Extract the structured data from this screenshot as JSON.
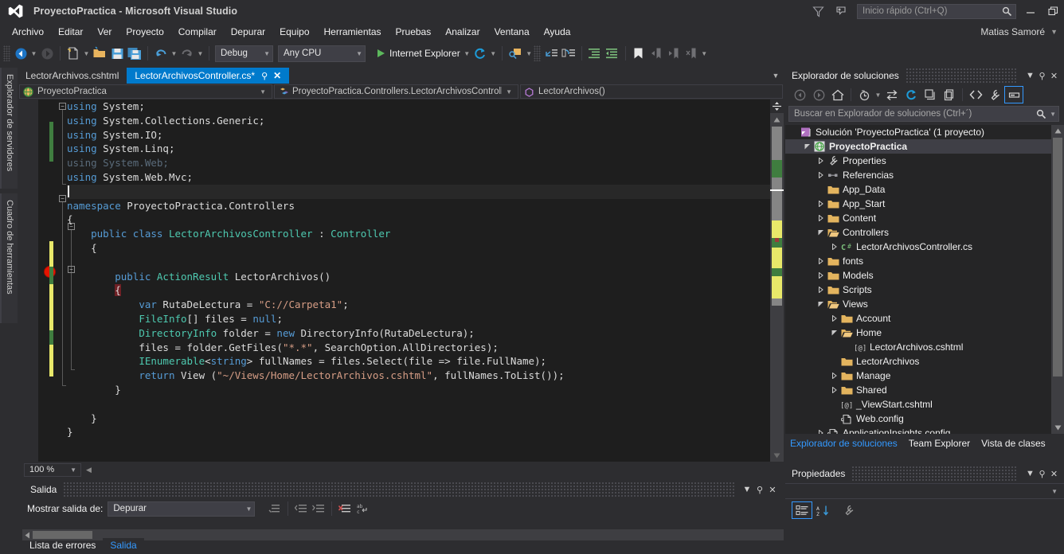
{
  "titlebar": {
    "title": "ProyectoPractica - Microsoft Visual Studio",
    "logo_icon": "visual-studio-logo-icon",
    "feedback_icon": "feedback-icon",
    "notify_icon": "notification-icon",
    "quick_launch_placeholder": "Inicio rápido (Ctrl+Q)",
    "quick_launch_value": "",
    "search_icon": "search-icon",
    "minimize_icon": "minimize-icon",
    "restore_icon": "restore-icon",
    "user": "Matias Samoré",
    "user_caret_icon": "chevron-down-icon"
  },
  "menubar": {
    "items": [
      "Archivo",
      "Editar",
      "Ver",
      "Proyecto",
      "Compilar",
      "Depurar",
      "Equipo",
      "Herramientas",
      "Pruebas",
      "Analizar",
      "Ventana",
      "Ayuda"
    ]
  },
  "toolbar": {
    "nav_back_icon": "navigate-back-icon",
    "nav_forward_icon": "navigate-forward-icon",
    "new_item_icon": "new-item-icon",
    "open_file_icon": "open-file-icon",
    "save_icon": "save-icon",
    "save_all_icon": "save-all-icon",
    "undo_icon": "undo-icon",
    "redo_icon": "redo-icon",
    "config_value": "Debug",
    "platform_value": "Any CPU",
    "run_label": "Internet Explorer",
    "run_icon": "play-icon",
    "refresh_icon": "refresh-icon",
    "find_icon": "find-in-files-icon",
    "step_into_icon": "step-into-icon",
    "step_over_icon": "step-over-icon",
    "indent_icon": "increase-indent-icon",
    "outdent_icon": "decrease-indent-icon",
    "bookmark_icon": "bookmark-icon",
    "prev_bookmark_icon": "previous-bookmark-icon",
    "next_bookmark_icon": "next-bookmark-icon",
    "clear_bookmark_icon": "clear-bookmark-icon",
    "overflow_icon": "toolbar-overflow-icon"
  },
  "left_vertical_tabs": [
    {
      "label": "Explorador de servidores",
      "icon": "server-explorer-icon"
    },
    {
      "label": "Cuadro de herramientas",
      "icon": "toolbox-icon"
    }
  ],
  "editor": {
    "tabs": [
      {
        "label": "LectorArchivos.cshtml",
        "active": false
      },
      {
        "label": "LectorArchivosController.cs*",
        "active": true
      }
    ],
    "tab_pin_icon": "pin-icon",
    "tab_close_icon": "close-icon",
    "tabstrip_overflow_icon": "chevron-down-icon",
    "navbar": {
      "project": "ProyectoPractica",
      "project_icon": "web-project-icon",
      "type": "ProyectoPractica.Controllers.LectorArchivosController",
      "type_icon": "class-icon",
      "member": "LectorArchivos()",
      "member_icon": "method-icon",
      "caret_icon": "chevron-down-icon"
    },
    "zoom_level": "100 %",
    "zoom_caret_icon": "chevron-down-icon",
    "scroll_up_icon": "scroll-up-arrow-icon",
    "scroll_down_icon": "scroll-down-arrow-icon",
    "split_icon": "split-view-icon",
    "breakpoint_icon": "breakpoint-icon",
    "code_lines": [
      {
        "indent": 0,
        "fold": "minus",
        "tokens": [
          [
            "kw",
            "using"
          ],
          [
            "pln",
            " "
          ],
          [
            "pln",
            "System;"
          ]
        ]
      },
      {
        "indent": 0,
        "tokens": [
          [
            "kw",
            "using"
          ],
          [
            "pln",
            " "
          ],
          [
            "pln",
            "System.Collections.Generic;"
          ]
        ]
      },
      {
        "indent": 0,
        "tokens": [
          [
            "kw",
            "using"
          ],
          [
            "pln",
            " "
          ],
          [
            "pln",
            "System.IO;"
          ]
        ]
      },
      {
        "indent": 0,
        "tokens": [
          [
            "kw",
            "using"
          ],
          [
            "pln",
            " "
          ],
          [
            "pln",
            "System.Linq;"
          ]
        ]
      },
      {
        "indent": 0,
        "dimmed": true,
        "tokens": [
          [
            "dim",
            "using System.Web;"
          ]
        ]
      },
      {
        "indent": 0,
        "tokens": [
          [
            "kw",
            "using"
          ],
          [
            "pln",
            " "
          ],
          [
            "pln",
            "System.Web.Mvc;"
          ]
        ]
      },
      {
        "indent": 0,
        "caret": true,
        "tokens": []
      },
      {
        "indent": 0,
        "fold": "minus",
        "tokens": [
          [
            "kw",
            "namespace"
          ],
          [
            "pln",
            " ProyectoPractica.Controllers"
          ]
        ]
      },
      {
        "indent": 0,
        "tokens": [
          [
            "pln",
            "{"
          ]
        ]
      },
      {
        "indent": 1,
        "fold": "minus",
        "tokens": [
          [
            "kw",
            "public"
          ],
          [
            "pln",
            " "
          ],
          [
            "kw",
            "class"
          ],
          [
            "pln",
            " "
          ],
          [
            "typ",
            "LectorArchivosController"
          ],
          [
            "pln",
            " : "
          ],
          [
            "typ",
            "Controller"
          ]
        ]
      },
      {
        "indent": 1,
        "tokens": [
          [
            "pln",
            "{"
          ]
        ]
      },
      {
        "indent": 1,
        "tokens": []
      },
      {
        "indent": 2,
        "fold": "minus",
        "tokens": [
          [
            "kw",
            "public"
          ],
          [
            "pln",
            " "
          ],
          [
            "typ",
            "ActionResult"
          ],
          [
            "pln",
            " LectorArchivos()"
          ]
        ]
      },
      {
        "indent": 2,
        "breakpoint_line": true,
        "tokens": [
          [
            "bp",
            "{"
          ]
        ]
      },
      {
        "indent": 3,
        "tokens": [
          [
            "kw",
            "var"
          ],
          [
            "pln",
            " RutaDeLectura = "
          ],
          [
            "str",
            "\"C://Carpeta1\""
          ],
          [
            "pln",
            ";"
          ]
        ]
      },
      {
        "indent": 3,
        "tokens": [
          [
            "typ",
            "FileInfo"
          ],
          [
            "pln",
            "[] files = "
          ],
          [
            "kw",
            "null"
          ],
          [
            "pln",
            ";"
          ]
        ]
      },
      {
        "indent": 3,
        "tokens": [
          [
            "typ",
            "DirectoryInfo"
          ],
          [
            "pln",
            " folder = "
          ],
          [
            "kw",
            "new"
          ],
          [
            "pln",
            " DirectoryInfo(RutaDeLectura);"
          ]
        ]
      },
      {
        "indent": 3,
        "tokens": [
          [
            "pln",
            "files = folder.GetFiles("
          ],
          [
            "str",
            "\"*.*\""
          ],
          [
            "pln",
            ", SearchOption.AllDirectories);"
          ]
        ]
      },
      {
        "indent": 3,
        "tokens": [
          [
            "typ",
            "IEnumerable"
          ],
          [
            "pln",
            "<"
          ],
          [
            "kw",
            "string"
          ],
          [
            "pln",
            "> fullNames = files.Select(file => file.FullName);"
          ]
        ]
      },
      {
        "indent": 3,
        "tokens": [
          [
            "kw",
            "return"
          ],
          [
            "pln",
            " View ("
          ],
          [
            "str",
            "\"~/Views/Home/LectorArchivos.cshtml\""
          ],
          [
            "pln",
            ", fullNames.ToList());"
          ]
        ]
      },
      {
        "indent": 2,
        "tokens": [
          [
            "pln",
            "}"
          ]
        ]
      },
      {
        "indent": 1,
        "tokens": []
      },
      {
        "indent": 1,
        "tokens": [
          [
            "pln",
            "}"
          ]
        ]
      },
      {
        "indent": 0,
        "tokens": [
          [
            "pln",
            "}"
          ]
        ]
      }
    ]
  },
  "output_panel": {
    "title": "Salida",
    "dropdown_icon": "chevron-down-icon",
    "pin_icon": "pin-icon",
    "close_icon": "close-icon",
    "show_output_label": "Mostrar salida de:",
    "show_output_value": "Depurar",
    "show_output_caret_icon": "chevron-down-icon",
    "tool_icons": [
      "find-message-icon",
      "go-to-previous-icon",
      "go-to-next-icon",
      "clear-all-icon",
      "toggle-word-wrap-icon"
    ],
    "scroll_left_icon": "scroll-left-arrow-icon"
  },
  "bottom_tabs": [
    {
      "label": "Lista de errores",
      "active": false
    },
    {
      "label": "Salida",
      "active": true
    }
  ],
  "solution_explorer": {
    "title": "Explorador de soluciones",
    "dropdown_icon": "chevron-down-icon",
    "pin_icon": "pin-icon",
    "close_icon": "close-icon",
    "toolbar_icons": [
      "back-icon",
      "forward-icon",
      "home-icon",
      "pending-changes-icon",
      "sync-with-active-document-icon",
      "refresh-icon",
      "collapse-all-icon",
      "show-all-files-icon",
      "view-code-icon",
      "properties-icon",
      "preview-selected-items-icon"
    ],
    "search_placeholder": "Buscar en Explorador de soluciones (Ctrl+´)",
    "search_value": "",
    "search_icon": "search-icon",
    "search_caret_icon": "chevron-down-icon",
    "scroll_up_icon": "scroll-up-arrow-icon",
    "scroll_down_icon": "scroll-down-arrow-icon",
    "tree": [
      {
        "depth": 0,
        "label": "Solución 'ProyectoPractica'  (1 proyecto)",
        "icon": "solution-icon",
        "arrow": "none",
        "selected": false
      },
      {
        "depth": 1,
        "label": "ProyectoPractica",
        "icon": "web-project-icon",
        "arrow": "expanded",
        "selected": true
      },
      {
        "depth": 2,
        "label": "Properties",
        "icon": "properties-wrench-icon",
        "arrow": "collapsed",
        "selected": false
      },
      {
        "depth": 2,
        "label": "Referencias",
        "icon": "references-icon",
        "arrow": "collapsed",
        "selected": false
      },
      {
        "depth": 2,
        "label": "App_Data",
        "icon": "folder-icon",
        "arrow": "none",
        "selected": false
      },
      {
        "depth": 2,
        "label": "App_Start",
        "icon": "folder-icon",
        "arrow": "collapsed",
        "selected": false
      },
      {
        "depth": 2,
        "label": "Content",
        "icon": "folder-icon",
        "arrow": "collapsed",
        "selected": false
      },
      {
        "depth": 2,
        "label": "Controllers",
        "icon": "folder-open-icon",
        "arrow": "expanded",
        "selected": false
      },
      {
        "depth": 3,
        "label": "LectorArchivosController.cs",
        "icon": "csharp-file-icon",
        "arrow": "collapsed",
        "selected": false
      },
      {
        "depth": 2,
        "label": "fonts",
        "icon": "folder-icon",
        "arrow": "collapsed",
        "selected": false
      },
      {
        "depth": 2,
        "label": "Models",
        "icon": "folder-icon",
        "arrow": "collapsed",
        "selected": false
      },
      {
        "depth": 2,
        "label": "Scripts",
        "icon": "folder-icon",
        "arrow": "collapsed",
        "selected": false
      },
      {
        "depth": 2,
        "label": "Views",
        "icon": "folder-open-icon",
        "arrow": "expanded",
        "selected": false
      },
      {
        "depth": 3,
        "label": "Account",
        "icon": "folder-icon",
        "arrow": "collapsed",
        "selected": false
      },
      {
        "depth": 3,
        "label": "Home",
        "icon": "folder-open-icon",
        "arrow": "expanded",
        "selected": false
      },
      {
        "depth": 4,
        "label": "LectorArchivos.cshtml",
        "icon": "cshtml-file-icon",
        "arrow": "none",
        "selected": false
      },
      {
        "depth": 3,
        "label": "LectorArchivos",
        "icon": "folder-icon",
        "arrow": "none",
        "selected": false
      },
      {
        "depth": 3,
        "label": "Manage",
        "icon": "folder-icon",
        "arrow": "collapsed",
        "selected": false
      },
      {
        "depth": 3,
        "label": "Shared",
        "icon": "folder-icon",
        "arrow": "collapsed",
        "selected": false
      },
      {
        "depth": 3,
        "label": "_ViewStart.cshtml",
        "icon": "cshtml-file-icon",
        "arrow": "none",
        "selected": false
      },
      {
        "depth": 3,
        "label": "Web.config",
        "icon": "config-file-icon",
        "arrow": "none",
        "selected": false
      },
      {
        "depth": 2,
        "label": "ApplicationInsights.config",
        "icon": "config-file-icon",
        "arrow": "collapsed",
        "selected": false
      }
    ],
    "tabs": [
      {
        "label": "Explorador de soluciones",
        "active": true
      },
      {
        "label": "Team Explorer",
        "active": false
      },
      {
        "label": "Vista de clases",
        "active": false
      }
    ]
  },
  "properties_panel": {
    "title": "Propiedades",
    "dropdown_icon": "chevron-down-icon",
    "pin_icon": "pin-icon",
    "close_icon": "close-icon",
    "object_caret_icon": "chevron-down-icon",
    "toolbar_icons": [
      "categorized-icon",
      "alphabetical-sort-icon",
      "property-pages-icon"
    ]
  },
  "colors": {
    "accent": "#007acc",
    "chrome_bg": "#2d2d30",
    "editor_bg": "#1e1e1e",
    "panel_bg": "#252526",
    "breakpoint_red": "#e51400",
    "link_blue": "#3399ff",
    "unsaved_yellow": "#e8e86a",
    "saved_green": "#3f7d3f"
  }
}
